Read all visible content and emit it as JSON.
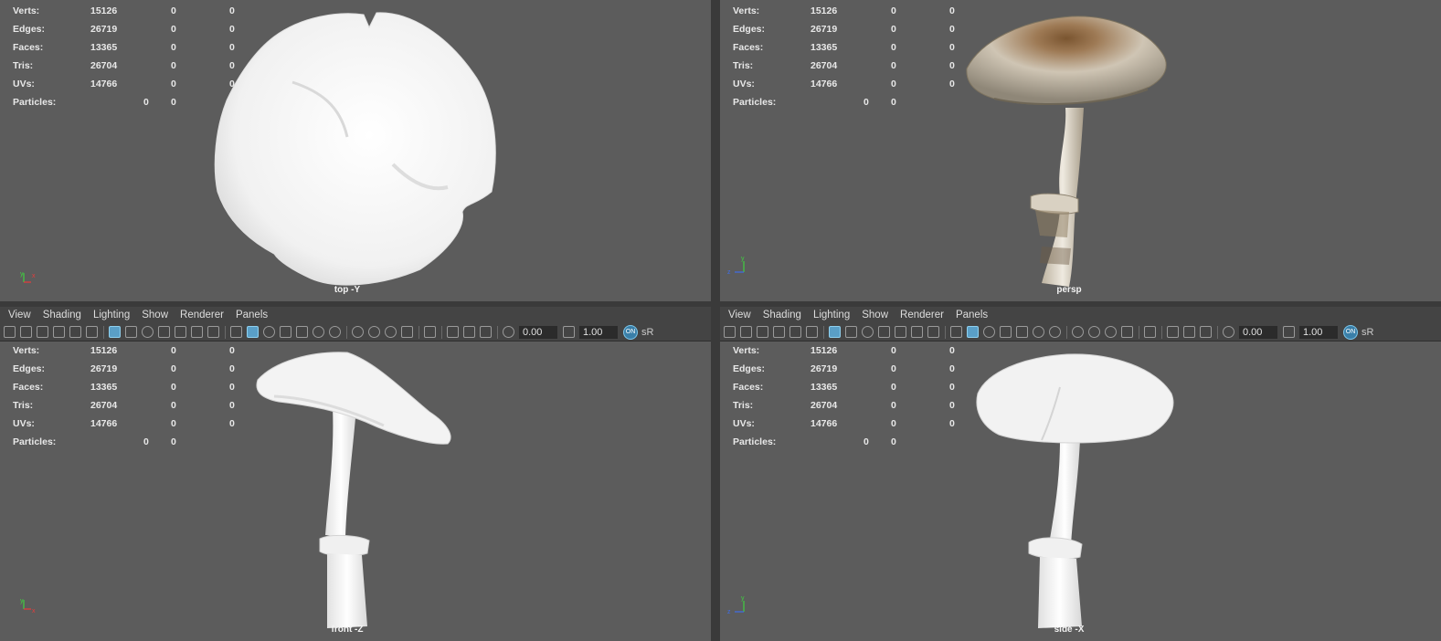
{
  "menu": [
    "View",
    "Shading",
    "Lighting",
    "Show",
    "Renderer",
    "Panels"
  ],
  "toolbar": {
    "exposure": "0.00",
    "gamma": "1.00",
    "badge": "ON",
    "colorspace": "sR"
  },
  "stats": {
    "labels": [
      "Verts:",
      "Edges:",
      "Faces:",
      "Tris:",
      "UVs:"
    ],
    "values": [
      "15126",
      "26719",
      "13365",
      "26704",
      "14766"
    ],
    "zero": "0",
    "particles_label": "Particles:"
  },
  "views": {
    "top": "top -Y",
    "persp": "persp",
    "front": "front -Z",
    "side": "side -X"
  },
  "axis": {
    "x": "x",
    "y": "y",
    "z": "z"
  },
  "colors": {
    "viewport_bg": "#5c5c5c",
    "panel_bg": "#444444",
    "accent": "#5a9fc7",
    "clay": "#f4f4f4"
  },
  "icons": {
    "toolbar": [
      "camera-select-icon",
      "camera-attributes-icon",
      "bookmark-icon",
      "image-plane-icon",
      "grid-pivot-icon",
      "two-d-pan-icon",
      "grid-toggle-icon",
      "film-gate-icon",
      "resolution-gate-icon",
      "gate-mask-icon",
      "field-chart-icon",
      "safe-action-icon",
      "safe-title-icon",
      "wireframe-icon",
      "smooth-shade-icon",
      "default-material-icon",
      "shaded-wireframe-icon",
      "textured-icon",
      "lights-icon",
      "shadows-icon",
      "ambient-occlusion-icon",
      "motion-blur-icon",
      "anti-aliasing-icon",
      "depth-of-field-icon",
      "isolate-select-icon",
      "xray-icon",
      "xray-joints-icon",
      "xray-components-icon",
      "exposure-icon",
      "gamma-icon",
      "color-management-icon"
    ]
  }
}
